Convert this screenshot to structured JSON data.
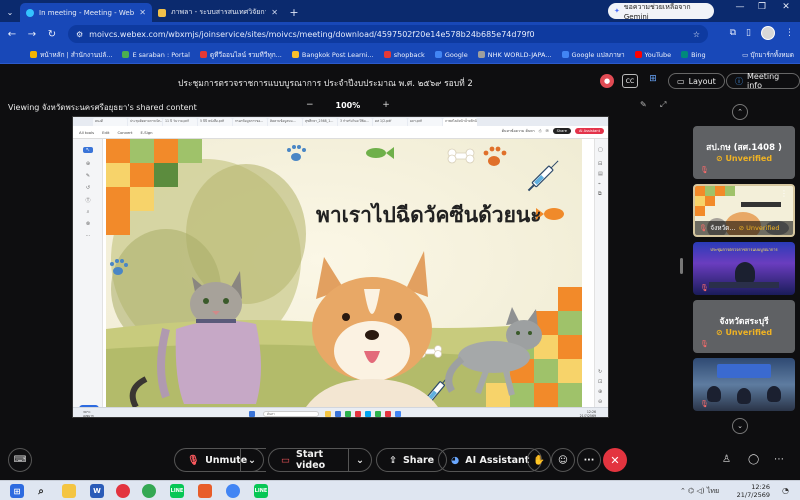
{
  "browser": {
    "tabs": [
      {
        "title": "In meeting - Meeting - Webex",
        "active": true
      },
      {
        "title": "ภาพลา - ระบบสารสนเทศวิจัยการศึกษา",
        "active": false
      }
    ],
    "new_tab": "+",
    "gemini_label": "ขอความช่วยเหลือจาก Gemini",
    "url": "moivcs.webex.com/wbxmjs/joinservice/sites/moivcs/meeting/download/4597502f20e14e578b24b685e74d79f0",
    "bookmarks": [
      {
        "label": "หน้าหลัก | สำนักงานปลั...",
        "color": "#f4b400"
      },
      {
        "label": "E saraban : Portal",
        "color": "#4caf50"
      },
      {
        "label": "ดูทีวีออนไลน์ รวมทีวีทุก...",
        "color": "#e53935"
      },
      {
        "label": "Bangkok Post Learni...",
        "color": "#fbc02d"
      },
      {
        "label": "shopback",
        "color": "#e53935"
      },
      {
        "label": "Google",
        "color": "#4285f4"
      },
      {
        "label": "NHK WORLD-JAPA...",
        "color": "#9e9e9e"
      },
      {
        "label": "Google แปลภาษา",
        "color": "#4285f4"
      },
      {
        "label": "YouTube",
        "color": "#ff0000"
      },
      {
        "label": "Bing",
        "color": "#00897b"
      }
    ],
    "all_bookmarks": "บุ๊กมาร์กทั้งหมด"
  },
  "meeting": {
    "title": "ประชุมการตรวจราชการแบบบูรณาการ ประจำปีงบประมาณ พ.ศ. ๒๕๖๙ รอบที่ 2",
    "cc_label": "CC",
    "layout_label": "Layout",
    "info_label": "Meeting info"
  },
  "share": {
    "viewing": "Viewing จังหวัดพระนครศรีอยุธยา's shared content",
    "zoom_out": "−",
    "zoom": "100%",
    "zoom_in": "+"
  },
  "doc": {
    "tabs": [
      "คนงดี",
      "ประชุมติดตามการเบิก...",
      "11 ปี วันวาย.pdf",
      "5 ปีปี หนังสือ.pdf",
      "กรอกข้อมูลการขอ...",
      "ติดตามข้อมูลนน...",
      "สุขศึกษา_2568_1...",
      "3 กำหรับวินย ปีฟิฉ...",
      "ดส 1/2.pdf",
      "ผลฯ.pdf",
      "ภาพสไลด์หน้าน้ำหลีกน้อย"
    ],
    "menu": [
      "All tools",
      "Edit",
      "Convert",
      "E-Sign"
    ],
    "search_text": "ค้นหาข้อความ ค้นหา",
    "share_btn": "Share",
    "ai_btn": "AI Assistant",
    "fab_label": "Present",
    "taskbar_search": "ค้นหา",
    "weather_temp": "30°C",
    "weather_desc": "เมฆมาก",
    "clock_time": "12:26",
    "clock_date": "21/7/2569"
  },
  "slide": {
    "headline": "พาเราไปฉีดวัคซีนด้วยนะ"
  },
  "participants": [
    {
      "name": "สป.กษ (สศ.1408 )",
      "status": "Unverified",
      "type": "name"
    },
    {
      "name": "จังหวัด...",
      "status": "Unverified",
      "type": "share-thumb"
    },
    {
      "name": "",
      "status": "",
      "type": "video",
      "video_title": "ประชุมการตรวจราชการแบบบูรณาการ"
    },
    {
      "name": "จังหวัดสระบุรี",
      "status": "Unverified",
      "type": "name"
    },
    {
      "name": "",
      "status": "",
      "type": "video2"
    }
  ],
  "controls": {
    "mute": "Unmute",
    "video": "Start video",
    "share": "Share",
    "ai": "AI Assistant",
    "more": "···"
  },
  "taskbar": {
    "lang": "ไทย",
    "time": "12:26",
    "date": "21/7/2569"
  }
}
